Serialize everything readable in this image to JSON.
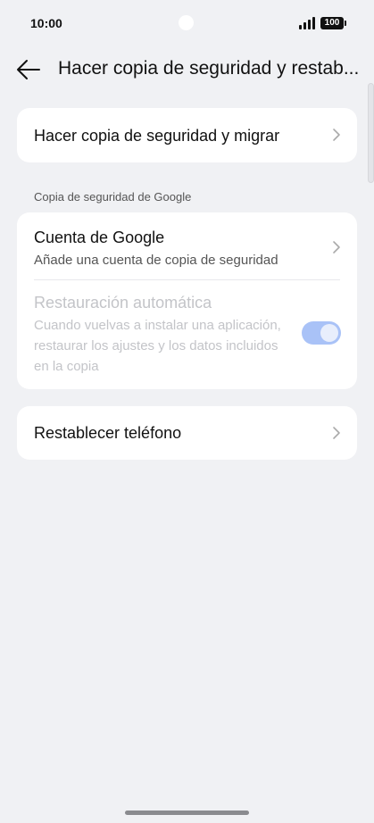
{
  "status_bar": {
    "time": "10:00",
    "battery": "100"
  },
  "app_bar": {
    "title": "Hacer copia de seguridad y restab...",
    "back_icon": "arrow-left-icon"
  },
  "backup_migrate": {
    "label": "Hacer copia de seguridad y migrar"
  },
  "google_backup": {
    "section_header": "Copia de seguridad de Google",
    "account": {
      "title": "Cuenta de Google",
      "subtitle": "Añade una cuenta de copia de seguridad"
    },
    "auto_restore": {
      "title": "Restauración automática",
      "description": "Cuando vuelvas a instalar una aplicación, restaurar los ajustes y los datos incluidos en la copia",
      "enabled": false,
      "toggle_on": true
    }
  },
  "reset_phone": {
    "label": "Restablecer teléfono"
  },
  "colors": {
    "background": "#f0f1f4",
    "card": "#ffffff",
    "toggle_track": "#a9c2f7",
    "disabled_text": "#c3c4c8"
  }
}
